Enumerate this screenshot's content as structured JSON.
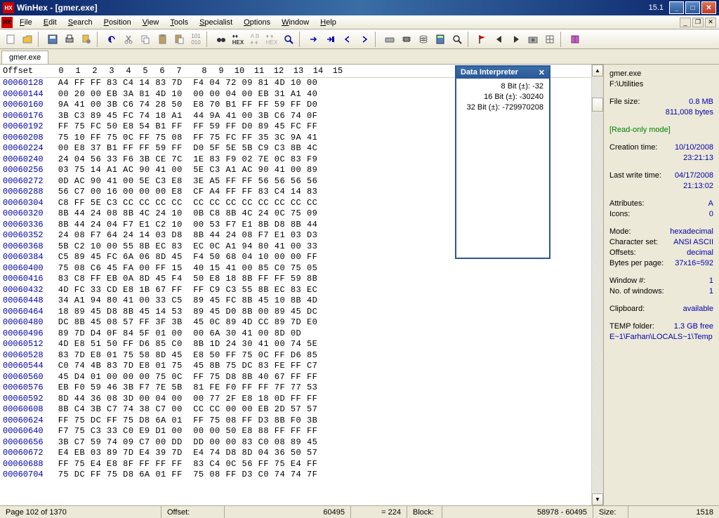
{
  "title": "WinHex - [gmer.exe]",
  "version": "15.1",
  "menu": [
    "File",
    "Edit",
    "Search",
    "Position",
    "View",
    "Tools",
    "Specialist",
    "Options",
    "Window",
    "Help"
  ],
  "tab": "gmer.exe",
  "offset_header": "Offset",
  "hex_cols": [
    "0",
    "1",
    "2",
    "3",
    "4",
    "5",
    "6",
    "7",
    "8",
    "9",
    "10",
    "11",
    "12",
    "13",
    "14",
    "15"
  ],
  "rows": [
    {
      "offset": "00060128",
      "hex": "A4 FF FF 83 C4 14 83 7D  F4 04 72 09 81 4D 10 00"
    },
    {
      "offset": "00060144",
      "hex": "00 20 00 EB 3A 81 4D 10  00 00 04 00 EB 31 A1 40"
    },
    {
      "offset": "00060160",
      "hex": "9A 41 00 3B C6 74 28 50  E8 70 B1 FF FF 59 FF D0"
    },
    {
      "offset": "00060176",
      "hex": "3B C3 89 45 FC 74 18 A1  44 9A 41 00 3B C6 74 0F"
    },
    {
      "offset": "00060192",
      "hex": "FF 75 FC 50 E8 54 B1 FF  FF 59 FF D0 89 45 FC FF"
    },
    {
      "offset": "00060208",
      "hex": "75 10 FF 75 0C FF 75 08  FF 75 FC FF 35 3C 9A 41"
    },
    {
      "offset": "00060224",
      "hex": "00 E8 37 B1 FF FF 59 FF  D0 5F 5E 5B C9 C3 8B 4C"
    },
    {
      "offset": "00060240",
      "hex": "24 04 56 33 F6 3B CE 7C  1E 83 F9 02 7E 0C 83 F9"
    },
    {
      "offset": "00060256",
      "hex": "03 75 14 A1 AC 90 41 00  5E C3 A1 AC 90 41 00 89"
    },
    {
      "offset": "00060272",
      "hex": "0D AC 90 41 00 5E C3 E8  3E A5 FF FF 56 56 56 56"
    },
    {
      "offset": "00060288",
      "hex": "56 C7 00 16 00 00 00 E8  CF A4 FF FF 83 C4 14 83"
    },
    {
      "offset": "00060304",
      "hex": "C8 FF 5E C3 CC CC CC CC  CC CC CC CC CC CC CC CC"
    },
    {
      "offset": "00060320",
      "hex": "8B 44 24 08 8B 4C 24 10  0B C8 8B 4C 24 0C 75 09"
    },
    {
      "offset": "00060336",
      "hex": "8B 44 24 04 F7 E1 C2 10  00 53 F7 E1 8B D8 8B 44"
    },
    {
      "offset": "00060352",
      "hex": "24 08 F7 64 24 14 03 D8  8B 44 24 08 F7 E1 03 D3"
    },
    {
      "offset": "00060368",
      "hex": "5B C2 10 00 55 8B EC 83  EC 0C A1 94 80 41 00 33"
    },
    {
      "offset": "00060384",
      "hex": "C5 89 45 FC 6A 06 8D 45  F4 50 68 04 10 00 00 FF"
    },
    {
      "offset": "00060400",
      "hex": "75 08 C6 45 FA 00 FF 15  40 15 41 00 85 C0 75 05"
    },
    {
      "offset": "00060416",
      "hex": "83 C8 FF EB 0A 8D 45 F4  50 E8 18 8B FF FF 59 8B"
    },
    {
      "offset": "00060432",
      "hex": "4D FC 33 CD E8 1B 67 FF  FF C9 C3 55 8B EC 83 EC"
    },
    {
      "offset": "00060448",
      "hex": "34 A1 94 80 41 00 33 C5  89 45 FC 8B 45 10 8B 4D"
    },
    {
      "offset": "00060464",
      "hex": "18 89 45 D8 8B 45 14 53  89 45 D0 8B 00 89 45 DC"
    },
    {
      "offset": "00060480",
      "hex": "DC 8B 45 08 57 FF 3F 3B  45 0C 89 4D CC 89 7D E0"
    },
    {
      "offset": "00060496",
      "hex": "89 7D D4 0F 84 5F 01 00  00 6A 30 41 00 8D 0D"
    },
    {
      "offset": "00060512",
      "hex": "4D E8 51 50 FF D6 85 C0  8B 1D 24 30 41 00 74 5E"
    },
    {
      "offset": "00060528",
      "hex": "83 7D E8 01 75 58 8D 45  E8 50 FF 75 0C FF D6 85"
    },
    {
      "offset": "00060544",
      "hex": "C0 74 4B 83 7D E8 01 75  45 8B 75 DC 83 FE FF C7"
    },
    {
      "offset": "00060560",
      "hex": "45 D4 01 00 00 00 75 0C  FF 75 D8 8B 40 67 FF FF"
    },
    {
      "offset": "00060576",
      "hex": "EB F0 59 46 3B F7 7E 5B  81 FE F0 FF FF 7F 77 53"
    },
    {
      "offset": "00060592",
      "hex": "8D 44 36 08 3D 00 04 00  00 77 2F E8 18 0D FF FF"
    },
    {
      "offset": "00060608",
      "hex": "8B C4 3B C7 74 38 C7 00  CC CC 00 00 EB 2D 57 57"
    },
    {
      "offset": "00060624",
      "hex": "FF 75 DC FF 75 D8 6A 01  FF 75 08 FF D3 8B F0 3B"
    },
    {
      "offset": "00060640",
      "hex": "F7 75 C3 33 C0 E9 D1 00  00 00 50 E8 88 FF FF FF"
    },
    {
      "offset": "00060656",
      "hex": "3B C7 59 74 09 C7 00 DD  DD 00 00 83 C0 08 89 45"
    },
    {
      "offset": "00060672",
      "hex": "E4 EB 03 89 7D E4 39 7D  E4 74 D8 8D 04 36 50 57"
    },
    {
      "offset": "00060688",
      "hex": "FF 75 E4 E8 8F FF FF FF  83 C4 0C 56 FF 75 E4 FF"
    },
    {
      "offset": "00060704",
      "hex": "75 DC FF 75 D8 6A 01 FF  75 08 FF D3 C0 74 74 7F"
    }
  ],
  "interpreter": {
    "title": "Data Interpreter",
    "lines": [
      "8 Bit (±): -32",
      "16 Bit (±): -30240",
      "32 Bit (±): -729970208"
    ]
  },
  "side": {
    "filename": "gmer.exe",
    "path": "F:\\Utilities",
    "filesize_label": "File size:",
    "filesize": "0.8 MB",
    "filebytes": "811,008 bytes",
    "readonly": "[Read-only mode]",
    "creation_label": "Creation time:",
    "creation_date": "10/10/2008",
    "creation_time": "23:21:13",
    "lastwrite_label": "Last write time:",
    "lastwrite_date": "04/17/2008",
    "lastwrite_time": "21:13:02",
    "attributes_label": "Attributes:",
    "attributes": "A",
    "icons_label": "Icons:",
    "icons": "0",
    "mode_label": "Mode:",
    "mode": "hexadecimal",
    "charset_label": "Character set:",
    "charset": "ANSI ASCII",
    "offsets_label": "Offsets:",
    "offsets": "decimal",
    "bpp_label": "Bytes per page:",
    "bpp": "37x16=592",
    "window_label": "Window #:",
    "window": "1",
    "nwindows_label": "No. of windows:",
    "nwindows": "1",
    "clipboard_label": "Clipboard:",
    "clipboard": "available",
    "temp_label": "TEMP folder:",
    "temp": "1.3 GB free",
    "temp_path": "E~1\\Farhan\\LOCALS~1\\Temp"
  },
  "status": {
    "page": "Page 102 of 1370",
    "offset_label": "Offset:",
    "offset": "60495",
    "eq": "= 224",
    "block_label": "Block:",
    "block": "58978 - 60495",
    "size_label": "Size:",
    "size": "1518"
  }
}
